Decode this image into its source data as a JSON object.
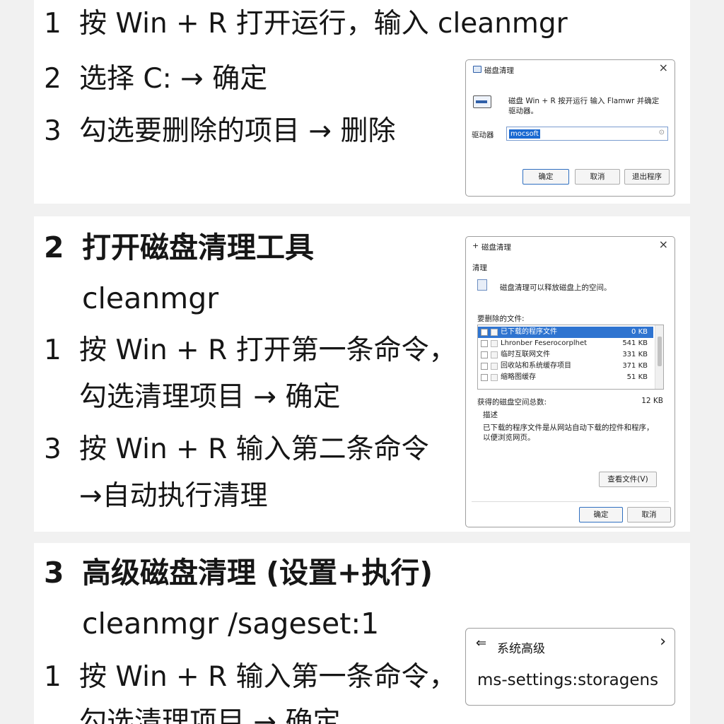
{
  "section1": {
    "steps": [
      {
        "num": "1",
        "text": "按 Win + R 打开运行，输入 cleanmgr"
      },
      {
        "num": "2",
        "text": "选择 C: → 确定"
      },
      {
        "num": "3",
        "text": "勾选要删除的项目 → 删除"
      }
    ],
    "dialog": {
      "title": "磁盘清理",
      "message_line1": "磁盘 Win + R 按开运行 输入 Flamwr 并确定",
      "message_line2": "驱动器。",
      "field_label": "驱动器",
      "field_value": "mocsoft",
      "buttons": [
        "确定",
        "取消",
        "退出程序"
      ]
    }
  },
  "section2": {
    "heading_num": "2",
    "heading": "打开磁盘清理工具",
    "command": "cleanmgr",
    "steps": [
      {
        "num": "1",
        "lines": [
          "按 Win + R 打开第一条命令，",
          "勾选清理项目 → 确定"
        ]
      },
      {
        "num": "3",
        "lines": [
          "按 Win + R 输入第二条命令",
          "→自动执行清理"
        ]
      }
    ],
    "dialog": {
      "title": "磁盘清理",
      "tab": "清理",
      "description": "磁盘清理可以释放磁盘上的空间。",
      "list_label": "要删除的文件:",
      "items": [
        {
          "name": "已下载的程序文件",
          "size": "0 KB"
        },
        {
          "name": "Lhronber Feserocorplhet",
          "size": "541 KB"
        },
        {
          "name": "临时互联网文件",
          "size": "331 KB"
        },
        {
          "name": "回收站和系统缓存项目",
          "size": "371 KB"
        },
        {
          "name": "缩略图缓存",
          "size": "51 KB"
        }
      ],
      "total_label": "获得的磁盘空间总数:",
      "total_value": "12 KB",
      "desc_heading": "描述",
      "desc_line1": "已下载的程序文件是从网站自动下载的控件和程序，",
      "desc_line2": "以便浏览网页。",
      "view_button": "查看文件(V)",
      "buttons": [
        "确定",
        "取消"
      ]
    }
  },
  "section3": {
    "heading_num": "3",
    "heading": "高级磁盘清理 (设置+执行)",
    "command": "cleanmgr /sageset:1",
    "steps": [
      {
        "num": "1",
        "lines": [
          "按 Win + R 输入第一条命令，",
          "勾选清理项目 → 确定"
        ]
      }
    ],
    "settings_box": {
      "back_icon": "back-arrow-icon",
      "title": "系统高级",
      "chevron": "›",
      "value": "ms-settings:storagens"
    }
  }
}
